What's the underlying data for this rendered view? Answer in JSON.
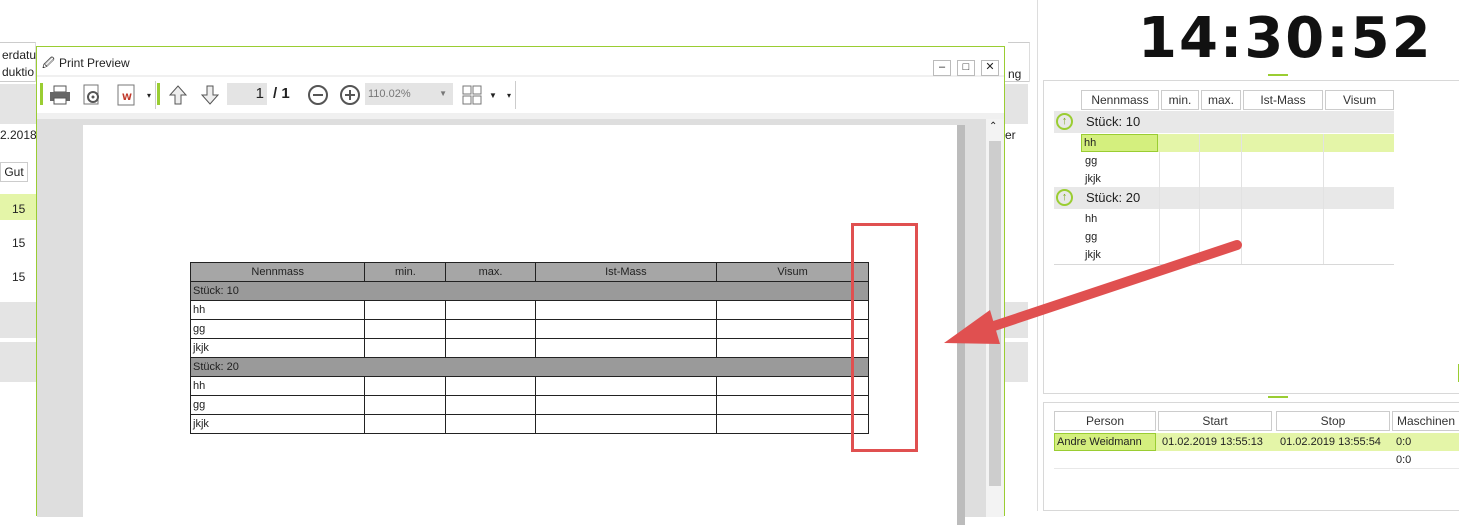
{
  "background_app": {
    "header_partial_1": "erdatu",
    "header_partial_2": "duktio",
    "header_right_partial": "ng",
    "date_partial": "2.2018",
    "filter_right_partial": "er",
    "gut_label": "Gut",
    "rows": [
      "15",
      "15",
      "15"
    ]
  },
  "print_preview": {
    "title": "Print Preview",
    "page_current": "1",
    "page_total": "/ 1",
    "zoom_value": "110.02%",
    "table": {
      "headers": [
        "Nennmass",
        "min.",
        "max.",
        "Ist-Mass",
        "Visum"
      ],
      "groups": [
        {
          "label": "Stück: 10",
          "rows": [
            "hh",
            "gg",
            "jkjk"
          ]
        },
        {
          "label": "Stück: 20",
          "rows": [
            "hh",
            "gg",
            "jkjk"
          ]
        }
      ]
    }
  },
  "clock": "14:30:52",
  "measure_grid": {
    "headers": [
      "Nennmass",
      "min.",
      "max.",
      "Ist-Mass",
      "Visum"
    ],
    "groups": [
      {
        "label": "Stück: 10",
        "rows": [
          "hh",
          "gg",
          "jkjk"
        ]
      },
      {
        "label": "Stück: 20",
        "rows": [
          "hh",
          "gg",
          "jkjk"
        ]
      }
    ]
  },
  "person_grid": {
    "headers": [
      "Person",
      "Start",
      "Stop",
      "Maschinen"
    ],
    "rows": [
      {
        "person": "Andre Weidmann",
        "start": "01.02.2019 13:55:13",
        "stop": "01.02.2019 13:55:54",
        "machine": "0:0"
      },
      {
        "person": "",
        "start": "",
        "stop": "",
        "machine": "0:0"
      }
    ]
  },
  "colors": {
    "accent": "#9acd32",
    "highlight": "#e4f5a8",
    "annotation": "#e05050"
  }
}
